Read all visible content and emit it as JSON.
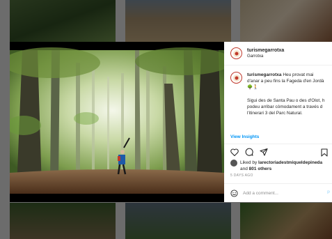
{
  "post": {
    "username": "turismegarrotxa",
    "location": "Garrotxa",
    "caption_line1": "Heu provat mai",
    "caption_line2": "d'anar a peu fins la Fageda d'en Jordà",
    "caption_emoji": "🌳🚶",
    "caption_para2_line1": "Sigui des de Santa Pau o des d'Olot, h",
    "caption_para2_line2": "podeu arribar còmodament a través d",
    "caption_para2_line3": "l'itinerari 3 del Parc Natural.",
    "view_insights": "View Insights",
    "liked_by_prefix": "Liked by",
    "liked_by_user": "larectoriadestmiqueldepineda",
    "liked_by_and": "and",
    "liked_by_others": "801 others",
    "time_ago": "5 DAYS AGO",
    "comment_placeholder": "Add a comment...",
    "comment_post": "P"
  },
  "icons": {
    "like": "heart-icon",
    "comment": "comment-icon",
    "share": "paper-plane-icon",
    "save": "bookmark-icon",
    "emoji": "smiley-icon"
  },
  "colors": {
    "link_blue": "#0095f6",
    "avatar_ring": "#c0392b",
    "muted": "#8e8e8e"
  }
}
